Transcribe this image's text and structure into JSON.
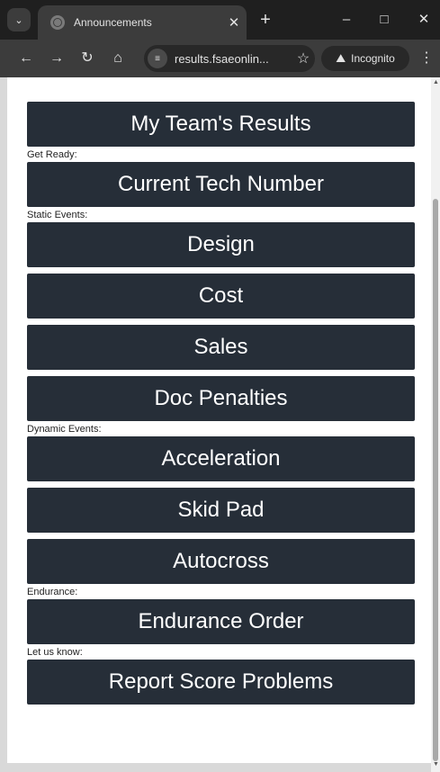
{
  "browser": {
    "tab_title": "Announcements",
    "url": "results.fsaeonlin...",
    "incognito_label": "Incognito"
  },
  "page": {
    "top_button": "My Team's Results",
    "sections": [
      {
        "label": "Get Ready:",
        "buttons": [
          "Current Tech Number"
        ]
      },
      {
        "label": "Static Events:",
        "buttons": [
          "Design",
          "Cost",
          "Sales",
          "Doc Penalties"
        ]
      },
      {
        "label": "Dynamic Events:",
        "buttons": [
          "Acceleration",
          "Skid Pad",
          "Autocross"
        ]
      },
      {
        "label": "Endurance:",
        "buttons": [
          "Endurance Order"
        ]
      },
      {
        "label": "Let us know:",
        "buttons": [
          "Report Score Problems"
        ]
      }
    ]
  },
  "theme": {
    "button_bg": "#262e38",
    "button_text": "#ffffff",
    "browser_frame": "#1f1f1f",
    "toolbar": "#3c3c3c"
  }
}
